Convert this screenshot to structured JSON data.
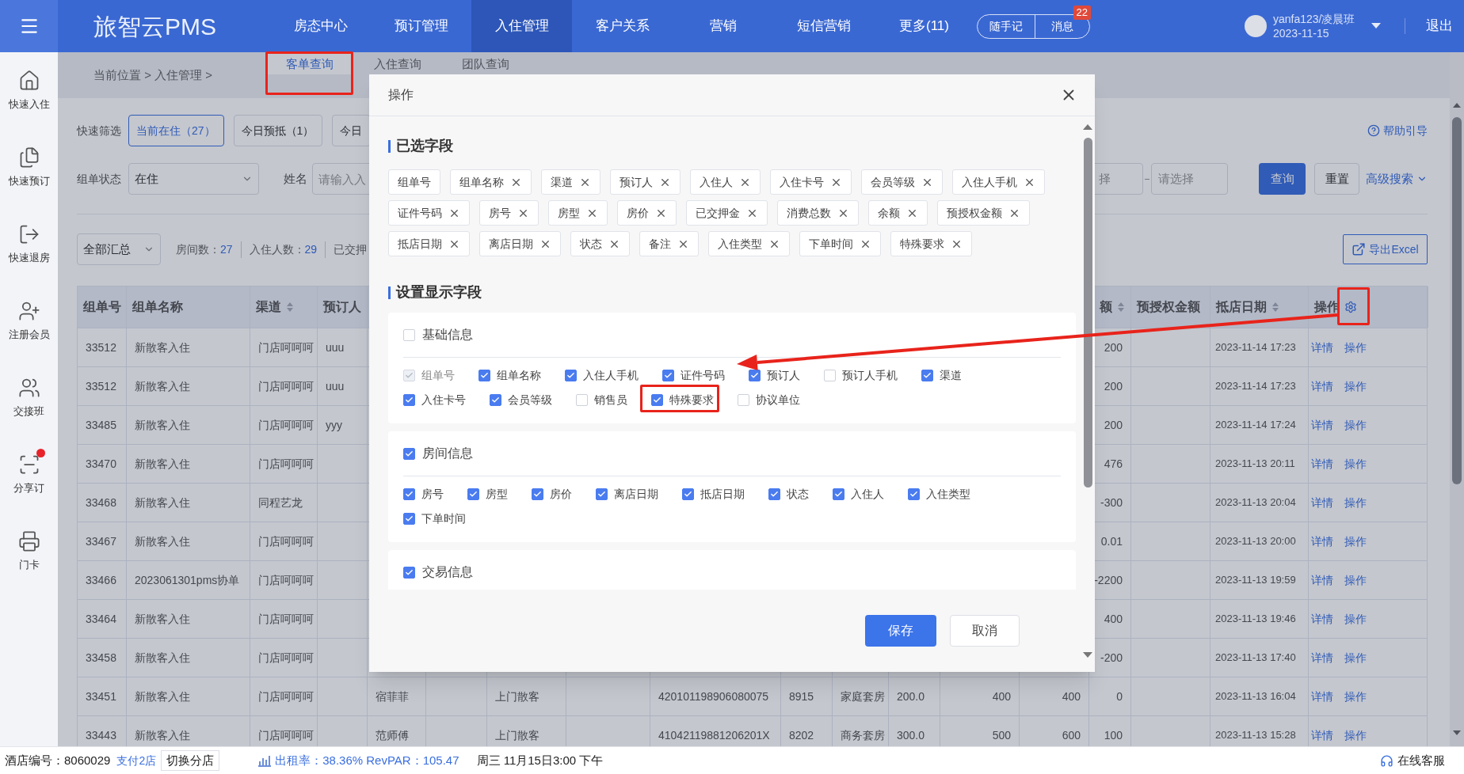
{
  "top_bar": {
    "logo": "旅智云PMS",
    "nav": [
      {
        "label": "房态中心",
        "selected": false
      },
      {
        "label": "预订管理",
        "selected": false
      },
      {
        "label": "入住管理",
        "selected": true
      },
      {
        "label": "客户关系",
        "selected": false
      },
      {
        "label": "营销",
        "selected": false
      },
      {
        "label": "短信营销",
        "selected": false
      },
      {
        "label": "更多(11)",
        "selected": false
      }
    ],
    "notes_button": "随手记",
    "messages_button": "消息",
    "messages_badge": "22",
    "user": "yanfa123/凌晨班",
    "date": "2023-11-15",
    "logout": "退出"
  },
  "sidebar": {
    "items": [
      {
        "label": "快速入住",
        "kind": "home",
        "alert": false
      },
      {
        "label": "快速预订",
        "kind": "booking",
        "alert": false
      },
      {
        "label": "快速退房",
        "kind": "checkout",
        "alert": false
      },
      {
        "label": "注册会员",
        "kind": "member",
        "alert": false
      },
      {
        "label": "交接班",
        "kind": "shift",
        "alert": false
      },
      {
        "label": "分享订",
        "kind": "share",
        "alert": true
      },
      {
        "label": "门卡",
        "kind": "card",
        "alert": false
      }
    ]
  },
  "breadcrumb": "当前位置 > 入住管理 >",
  "page_tabs": [
    {
      "label": "客单查询",
      "selected": true
    },
    {
      "label": "入住查询",
      "selected": false
    },
    {
      "label": "团队查询",
      "selected": false
    }
  ],
  "help_link": "帮助引导",
  "quick_filter": {
    "label": "快速筛选",
    "options": [
      {
        "label": "当前在住（27）",
        "selected": true
      },
      {
        "label": "今日预抵（1）",
        "selected": false
      },
      {
        "label": "今日",
        "selected": false
      }
    ]
  },
  "search": {
    "status_label": "组单状态",
    "status_value": "在住",
    "name_label": "姓名",
    "name_placeholder": "请输入入",
    "range_start_placeholder": "择",
    "range_end_placeholder": "请选择",
    "query_button": "查询",
    "reset_button": "重置",
    "advanced_search": "高级搜索"
  },
  "summary": {
    "scope": "全部汇总",
    "stats": [
      {
        "label": "房间数：",
        "value": "27"
      },
      {
        "label": "入住人数：",
        "value": "29"
      },
      {
        "label": "已交押"
      }
    ]
  },
  "export_button": "导出Excel",
  "table": {
    "columns": [
      {
        "label": "组单号",
        "sortable": false
      },
      {
        "label": "组单名称",
        "sortable": false
      },
      {
        "label": "渠道",
        "sortable": true
      },
      {
        "label": "预订人",
        "sortable": false
      },
      {},
      {},
      {},
      {},
      {},
      {},
      {},
      {},
      {},
      {},
      {
        "label": "额",
        "sortable": true
      },
      {
        "label": "预授权金额",
        "sortable": false
      },
      {
        "label": "抵店日期",
        "sortable": true
      },
      {
        "label": "操作",
        "sortable": false
      }
    ],
    "rows": [
      {
        "cells": [
          "33512",
          "新散客入住",
          "门店呵呵呵",
          "uuu",
          null,
          null,
          null,
          null,
          null,
          null,
          null,
          null,
          null,
          null,
          "200",
          null,
          "2023-11-14 17:23"
        ],
        "actions": [
          "详情",
          "操作"
        ]
      },
      {
        "cells": [
          "33512",
          "新散客入住",
          "门店呵呵呵",
          "uuu",
          null,
          null,
          null,
          null,
          null,
          null,
          null,
          null,
          null,
          null,
          "200",
          null,
          "2023-11-14 17:23"
        ],
        "actions": [
          "详情",
          "操作"
        ]
      },
      {
        "cells": [
          "33485",
          "新散客入住",
          "门店呵呵呵",
          "yyy",
          null,
          null,
          null,
          null,
          null,
          null,
          null,
          null,
          null,
          null,
          "200",
          null,
          "2023-11-14 17:24"
        ],
        "actions": [
          "详情",
          "操作"
        ]
      },
      {
        "cells": [
          "33470",
          "新散客入住",
          "门店呵呵呵",
          null,
          null,
          null,
          null,
          null,
          null,
          null,
          null,
          null,
          null,
          null,
          "476",
          null,
          "2023-11-13 20:11"
        ],
        "actions": [
          "详情",
          "操作"
        ]
      },
      {
        "cells": [
          "33468",
          "新散客入住",
          "同程艺龙",
          null,
          null,
          null,
          null,
          null,
          null,
          null,
          null,
          null,
          null,
          null,
          "-300",
          null,
          "2023-11-13 20:04"
        ],
        "actions": [
          "详情",
          "操作"
        ]
      },
      {
        "cells": [
          "33467",
          "新散客入住",
          "门店呵呵呵",
          null,
          null,
          null,
          null,
          null,
          null,
          null,
          null,
          null,
          null,
          null,
          "0.01",
          null,
          "2023-11-13 20:00"
        ],
        "actions": [
          "详情",
          "操作"
        ]
      },
      {
        "cells": [
          "33466",
          "2023061301pms协单",
          "门店呵呵呵",
          null,
          null,
          null,
          null,
          null,
          null,
          null,
          null,
          null,
          null,
          null,
          "-2200",
          null,
          "2023-11-13 19:59"
        ],
        "actions": [
          "详情",
          "操作"
        ]
      },
      {
        "cells": [
          "33464",
          "新散客入住",
          "门店呵呵呵",
          null,
          null,
          null,
          null,
          null,
          null,
          null,
          null,
          null,
          null,
          null,
          "400",
          null,
          "2023-11-13 19:46"
        ],
        "actions": [
          "详情",
          "操作"
        ]
      },
      {
        "cells": [
          "33458",
          "新散客入住",
          "门店呵呵呵",
          null,
          null,
          null,
          null,
          null,
          null,
          null,
          null,
          null,
          null,
          null,
          "-200",
          null,
          "2023-11-13 17:40"
        ],
        "actions": [
          "详情",
          "操作"
        ]
      },
      {
        "cells": [
          "33451",
          "新散客入住",
          "门店呵呵呵",
          null,
          "宿菲菲",
          null,
          "上门散客",
          null,
          "420101198906080075",
          "8915",
          "家庭套房",
          "200.0",
          "400",
          "400",
          "0",
          null,
          "2023-11-13 16:04"
        ],
        "actions": [
          "详情",
          "操作"
        ]
      },
      {
        "cells": [
          "33443",
          "新散客入住",
          "门店呵呵呵",
          null,
          "范师傅",
          null,
          "上门散客",
          null,
          "41042119881206201X",
          "8202",
          "商务套房",
          "300.0",
          "500",
          "600",
          "100",
          null,
          "2023-11-13 15:28"
        ],
        "actions": [
          "详情",
          "操作"
        ]
      }
    ]
  },
  "modal": {
    "title": "操作",
    "selected_title": "已选字段",
    "selected_fields": [
      {
        "label": "组单号",
        "removable": false
      },
      {
        "label": "组单名称",
        "removable": true
      },
      {
        "label": "渠道",
        "removable": true
      },
      {
        "label": "预订人",
        "removable": true
      },
      {
        "label": "入住人",
        "removable": true
      },
      {
        "label": "入住卡号",
        "removable": true
      },
      {
        "label": "会员等级",
        "removable": true
      },
      {
        "label": "入住人手机",
        "removable": true
      },
      {
        "label": "证件号码",
        "removable": true
      },
      {
        "label": "房号",
        "removable": true
      },
      {
        "label": "房型",
        "removable": true
      },
      {
        "label": "房价",
        "removable": true
      },
      {
        "label": "已交押金",
        "removable": true
      },
      {
        "label": "消费总数",
        "removable": true
      },
      {
        "label": "余额",
        "removable": true
      },
      {
        "label": "预授权金额",
        "removable": true
      },
      {
        "label": "抵店日期",
        "removable": true
      },
      {
        "label": "离店日期",
        "removable": true
      },
      {
        "label": "状态",
        "removable": true
      },
      {
        "label": "备注",
        "removable": true
      },
      {
        "label": "入住类型",
        "removable": true
      },
      {
        "label": "下单时间",
        "removable": true
      },
      {
        "label": "特殊要求",
        "removable": true
      }
    ],
    "settings_title": "设置显示字段",
    "groups": [
      {
        "label": "基础信息",
        "checked": false,
        "fields": [
          {
            "label": "组单号",
            "checked": true,
            "disabled": true
          },
          {
            "label": "组单名称",
            "checked": true,
            "disabled": false
          },
          {
            "label": "入住人手机",
            "checked": true,
            "disabled": false
          },
          {
            "label": "证件号码",
            "checked": true,
            "disabled": false
          },
          {
            "label": "预订人",
            "checked": true,
            "disabled": false
          },
          {
            "label": "预订人手机",
            "checked": false,
            "disabled": false
          },
          {
            "label": "渠道",
            "checked": true,
            "disabled": false
          },
          {
            "label": "入住卡号",
            "checked": true,
            "disabled": false
          },
          {
            "label": "会员等级",
            "checked": true,
            "disabled": false
          },
          {
            "label": "销售员",
            "checked": false,
            "disabled": false
          },
          {
            "label": "特殊要求",
            "checked": true,
            "disabled": false
          },
          {
            "label": "协议单位",
            "checked": false,
            "disabled": false
          }
        ]
      },
      {
        "label": "房间信息",
        "checked": true,
        "fields": [
          {
            "label": "房号",
            "checked": true,
            "disabled": false
          },
          {
            "label": "房型",
            "checked": true,
            "disabled": false
          },
          {
            "label": "房价",
            "checked": true,
            "disabled": false
          },
          {
            "label": "离店日期",
            "checked": true,
            "disabled": false
          },
          {
            "label": "抵店日期",
            "checked": true,
            "disabled": false
          },
          {
            "label": "状态",
            "checked": true,
            "disabled": false
          },
          {
            "label": "入住人",
            "checked": true,
            "disabled": false
          },
          {
            "label": "入住类型",
            "checked": true,
            "disabled": false
          },
          {
            "label": "下单时间",
            "checked": true,
            "disabled": false
          }
        ]
      },
      {
        "label": "交易信息",
        "checked": true
      }
    ],
    "save_button": "保存",
    "cancel_button": "取消"
  },
  "status_bar": {
    "hotel": "酒店编号：8060029",
    "branch_link": "支付2店",
    "switch_button": "切换分店",
    "occupancy": "出租率：38.36% RevPAR：105.47",
    "datetime": "周三 11月15日3:00 下午",
    "support": "在线客服"
  }
}
